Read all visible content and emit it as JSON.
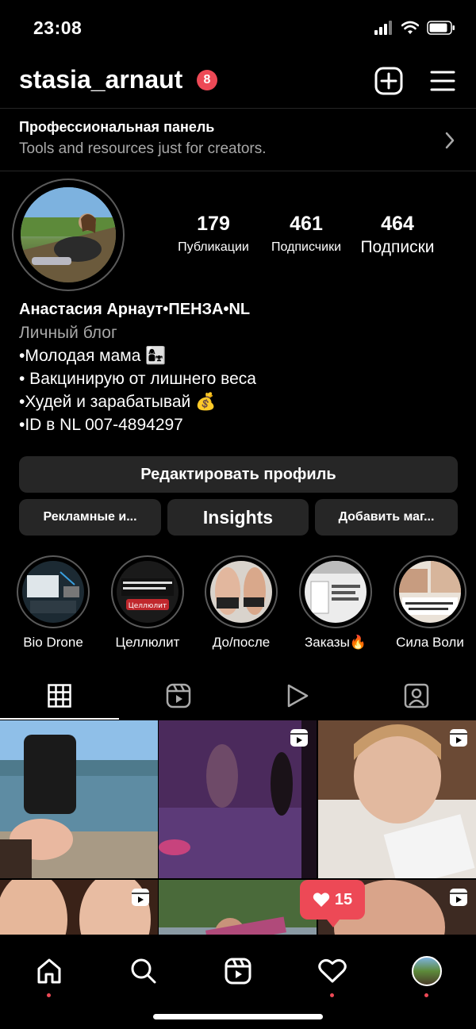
{
  "status": {
    "time": "23:08"
  },
  "header": {
    "username": "stasia_arnaut",
    "notifications": "8"
  },
  "pro_panel": {
    "title": "Профессиональная панель",
    "subtitle": "Tools and resources just for creators."
  },
  "stats": [
    {
      "value": "179",
      "label": "Публикации"
    },
    {
      "value": "461",
      "label": "Подписчики"
    },
    {
      "value": "464",
      "label": "Подписки"
    }
  ],
  "bio": {
    "name": "Анастасия Арнаут•ПЕНЗА•NL",
    "category": "Личный блог",
    "lines": [
      "•Молодая мама 👩‍👧",
      "• Вакцинирую от лишнего веса",
      "•Худей и зарабатывай 💰",
      "•ID в NL 007-4894297"
    ]
  },
  "buttons": {
    "edit": "Редактировать профиль",
    "ads": "Рекламные и...",
    "insights": "Insights",
    "shop": "Добавить маг..."
  },
  "highlights": [
    {
      "label": "Bio Drone",
      "icon": "bio-drone-thumb"
    },
    {
      "label": "Целлюлит",
      "icon": "cellulite-thumb",
      "caption": "Целлюлит"
    },
    {
      "label": "До/после",
      "icon": "before-after-thumb"
    },
    {
      "label": "Заказы🔥",
      "icon": "orders-thumb"
    },
    {
      "label": "Сила Воли",
      "icon": "willpower-thumb"
    }
  ],
  "tabs": [
    "grid-icon",
    "reels-icon",
    "video-play-icon",
    "tagged-icon"
  ],
  "likes_notification": {
    "count": "15"
  },
  "nav": [
    "home-icon",
    "search-icon",
    "reels-icon",
    "heart-icon",
    "profile-avatar"
  ],
  "colors": {
    "accent": "#ed4956",
    "button_bg": "#262626",
    "secondary_text": "#a8a8a8"
  }
}
